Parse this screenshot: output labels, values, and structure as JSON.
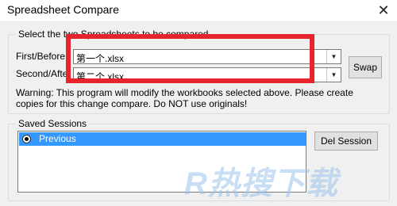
{
  "window": {
    "title": "Spreadsheet Compare",
    "close_glyph": "✕"
  },
  "select_group": {
    "legend": "Select the two Spreadsheets to be compared",
    "first_label": "First/Before:",
    "first_value": "第一个.xlsx",
    "second_label": "Second/After:",
    "second_value": "第二个.xlsx",
    "swap_label": "Swap",
    "dropdown_glyph": "▼",
    "warning": "Warning: This program will modify the workbooks selected above. Please create copies for this change compare. Do NOT use originals!"
  },
  "sessions_group": {
    "legend": "Saved Sessions",
    "items": [
      {
        "label": "Previous",
        "selected": true
      }
    ],
    "del_label": "Del Session"
  },
  "watermark": "R热搜下载",
  "colors": {
    "annotation": "#e8232e",
    "selection": "#3399ff",
    "watermark": "#9cc4ec"
  }
}
